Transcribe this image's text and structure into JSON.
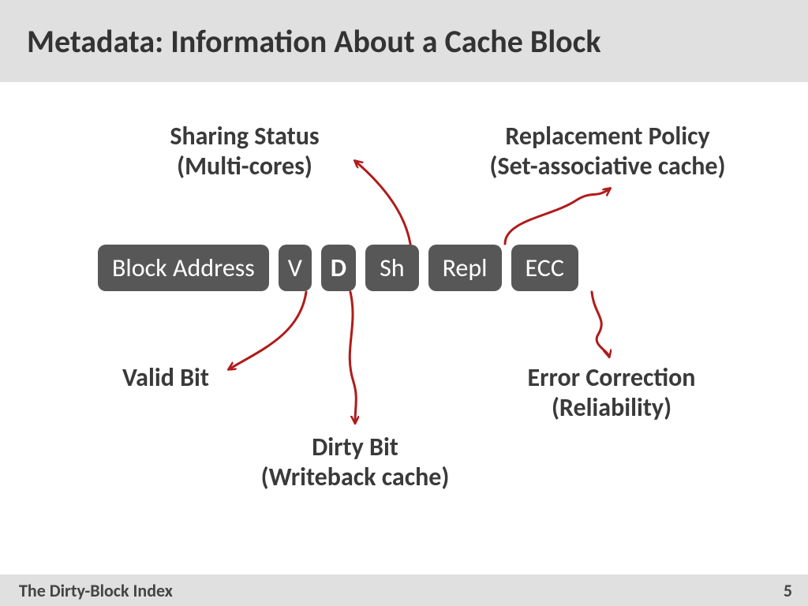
{
  "title": "Metadata: Information About a Cache Block",
  "footer": {
    "left": "The Dirty-Block Index",
    "page": "5"
  },
  "fields": {
    "block_addr": "Block Address",
    "v": "V",
    "d": "D",
    "sh": "Sh",
    "repl": "Repl",
    "ecc": "ECC"
  },
  "annotations": {
    "sharing": {
      "line1": "Sharing Status",
      "line2": "(Multi-cores)"
    },
    "replacement": {
      "line1": "Replacement Policy",
      "line2": "(Set-associative cache)"
    },
    "valid": {
      "line1": "Valid Bit"
    },
    "dirty": {
      "line1": "Dirty Bit",
      "line2": "(Writeback cache)"
    },
    "ecc": {
      "line1": "Error Correction",
      "line2": "(Reliability)"
    }
  },
  "colors": {
    "arrow": "#b01b1b",
    "field_bg": "#575757"
  }
}
